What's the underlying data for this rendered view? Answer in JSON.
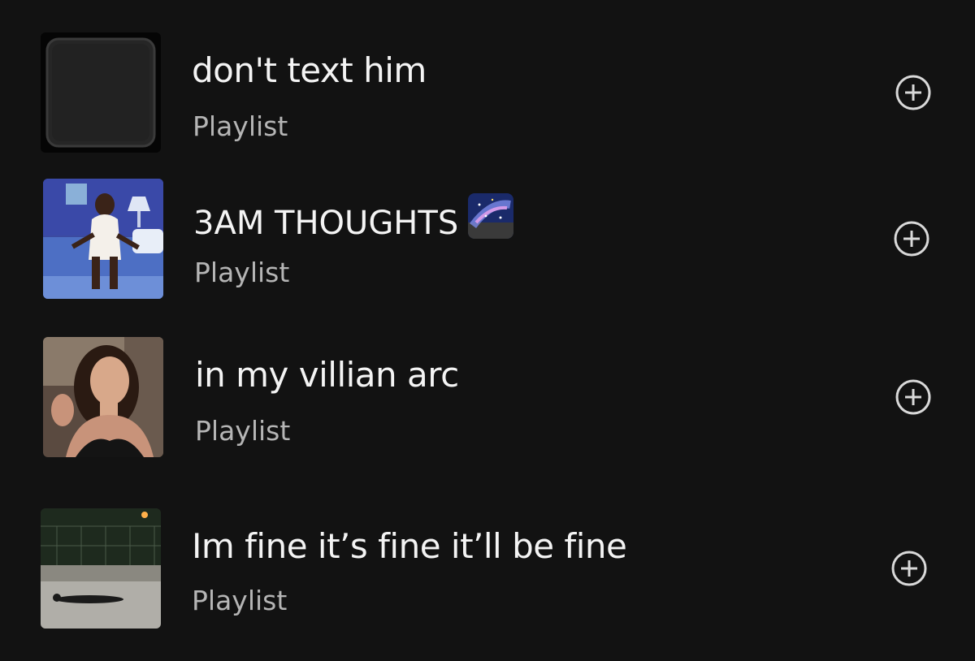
{
  "playlists": [
    {
      "title": "don't text him",
      "subtitle": "Playlist",
      "cover": "black-square-cover",
      "action_icon": "add-circle-icon"
    },
    {
      "title": "3AM THOUGHTS",
      "emoji": "milky-way-emoji",
      "subtitle": "Playlist",
      "cover": "painting-woman-on-bed-cover",
      "action_icon": "add-circle-icon"
    },
    {
      "title": "in my villian arc",
      "subtitle": "Playlist",
      "cover": "woman-portrait-cover",
      "action_icon": "add-circle-icon"
    },
    {
      "title": "Im fine it’s fine it’ll be fine",
      "subtitle": "Playlist",
      "cover": "person-lying-on-court-cover",
      "action_icon": "add-circle-icon"
    }
  ],
  "colors": {
    "background": "#121212",
    "title": "#f4f4f4",
    "subtitle": "#b5b5b5",
    "icon": "#d9d9d9"
  }
}
